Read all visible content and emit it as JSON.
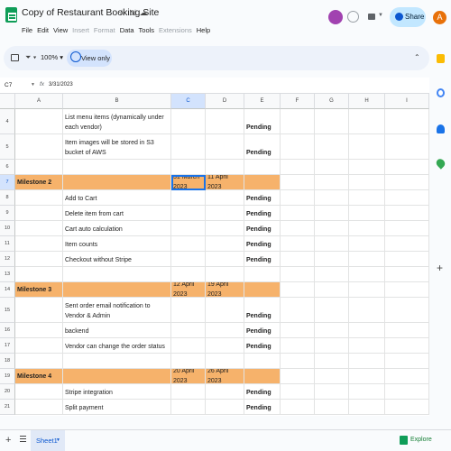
{
  "app": {
    "title": "Copy of Restaurant Booking Site",
    "menus": [
      {
        "label": "File",
        "enabled": true
      },
      {
        "label": "Edit",
        "enabled": true
      },
      {
        "label": "View",
        "enabled": true
      },
      {
        "label": "Insert",
        "enabled": false
      },
      {
        "label": "Format",
        "enabled": false
      },
      {
        "label": "Data",
        "enabled": true
      },
      {
        "label": "Tools",
        "enabled": true
      },
      {
        "label": "Extensions",
        "enabled": false
      },
      {
        "label": "Help",
        "enabled": true
      }
    ],
    "user_initial": "A",
    "collab_initial": "",
    "share_label": "Share"
  },
  "toolbar": {
    "zoom": "100%",
    "view_only_label": "View only"
  },
  "formula_bar": {
    "cell_ref": "C7",
    "fx": "fx",
    "value": "3/31/2023"
  },
  "grid": {
    "columns": [
      "A",
      "B",
      "C",
      "D",
      "E",
      "F",
      "G",
      "H",
      "I"
    ],
    "selected_column": "C",
    "selected_row": "7",
    "rows": [
      {
        "num": "4",
        "type": "normal",
        "a": "",
        "b": "List menu items (dynamically under each vendor)",
        "c": "",
        "d": "",
        "e": "Pending"
      },
      {
        "num": "5",
        "type": "normal",
        "a": "",
        "b": "Item images will be stored in S3 bucket of AWS",
        "c": "",
        "d": "",
        "e": "Pending"
      },
      {
        "num": "6",
        "type": "normal",
        "a": "",
        "b": "",
        "c": "",
        "d": "",
        "e": ""
      },
      {
        "num": "7",
        "type": "milestone",
        "a": "Milestone 2",
        "b": "",
        "c": "31 March 2023",
        "d": "11 April 2023",
        "e": ""
      },
      {
        "num": "8",
        "type": "normal",
        "a": "",
        "b": "Add to Cart",
        "c": "",
        "d": "",
        "e": "Pending"
      },
      {
        "num": "9",
        "type": "normal",
        "a": "",
        "b": "Delete item from cart",
        "c": "",
        "d": "",
        "e": "Pending"
      },
      {
        "num": "10",
        "type": "normal",
        "a": "",
        "b": "Cart auto calculation",
        "c": "",
        "d": "",
        "e": "Pending"
      },
      {
        "num": "11",
        "type": "normal",
        "a": "",
        "b": "Item counts",
        "c": "",
        "d": "",
        "e": "Pending"
      },
      {
        "num": "12",
        "type": "normal",
        "a": "",
        "b": "Checkout without Stripe",
        "c": "",
        "d": "",
        "e": "Pending"
      },
      {
        "num": "13",
        "type": "normal",
        "a": "",
        "b": "",
        "c": "",
        "d": "",
        "e": ""
      },
      {
        "num": "14",
        "type": "milestone",
        "a": "Milestone 3",
        "b": "",
        "c": "12 April 2023",
        "d": "19 April 2023",
        "e": ""
      },
      {
        "num": "15",
        "type": "normal",
        "a": "",
        "b": "Sent order email notification to Vendor & Admin",
        "c": "",
        "d": "",
        "e": "Pending"
      },
      {
        "num": "16",
        "type": "normal",
        "a": "",
        "b": "Add the order in the Admin & Vendor backend",
        "c": "",
        "d": "",
        "e": "Pending"
      },
      {
        "num": "17",
        "type": "normal",
        "a": "",
        "b": "Vendor can change the order status",
        "c": "",
        "d": "",
        "e": "Pending"
      },
      {
        "num": "18",
        "type": "normal",
        "a": "",
        "b": "",
        "c": "",
        "d": "",
        "e": ""
      },
      {
        "num": "19",
        "type": "milestone",
        "a": "Milestone 4",
        "b": "",
        "c": "20 April 2023",
        "d": "26 April 2023",
        "e": ""
      },
      {
        "num": "20",
        "type": "normal",
        "a": "",
        "b": "Stripe integration",
        "c": "",
        "d": "",
        "e": "Pending"
      },
      {
        "num": "21",
        "type": "normal",
        "a": "",
        "b": "Split payment",
        "c": "",
        "d": "",
        "e": "Pending"
      }
    ]
  },
  "bottom": {
    "sheet_tab": "Sheet1",
    "explore_label": "Explore"
  },
  "colors": {
    "milestone_fill": "#f6b26b",
    "selection": "#1a73e8",
    "share_bg": "#c2e7ff"
  }
}
